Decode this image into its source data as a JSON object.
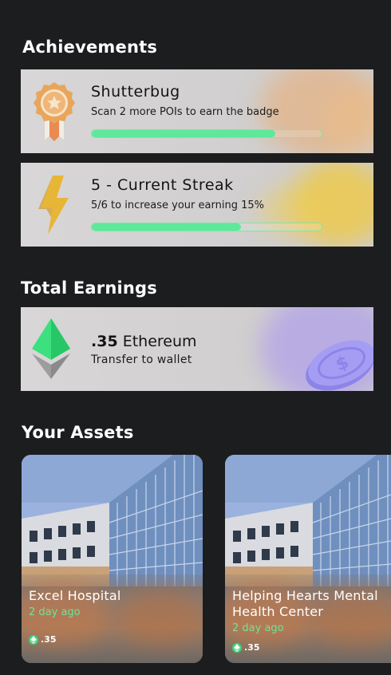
{
  "achievements": {
    "title": "Achievements",
    "items": [
      {
        "title": "Shutterbug",
        "subtitle": "Scan 2 more POIs to earn the badge",
        "progress": 0.8,
        "icon": "medal-icon"
      },
      {
        "title": "5 - Current Streak",
        "subtitle": "5/6 to increase your earning 15%",
        "progress": 0.65,
        "icon": "lightning-icon"
      }
    ]
  },
  "earnings": {
    "title": "Total Earnings",
    "amount": ".35",
    "currency": "Ethereum",
    "action": "Transfer to wallet",
    "icon": "ethereum-icon"
  },
  "assets": {
    "title": "Your Assets",
    "items": [
      {
        "name": "Excel Hospital",
        "time": "2 day ago",
        "price": ".35"
      },
      {
        "name": "Helping Hearts Mental Health Center",
        "time": "2 day ago",
        "price": ".35"
      }
    ]
  },
  "colors": {
    "background": "#1c1d1f",
    "accent_green": "#5ee89a",
    "card_bg": "#d5d3d3"
  }
}
